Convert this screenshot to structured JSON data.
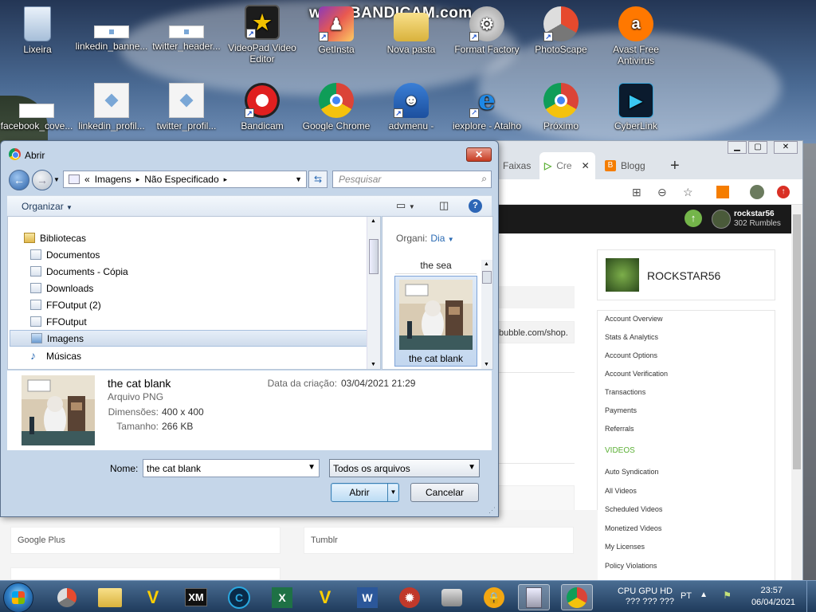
{
  "desktop": {
    "watermark": "www.BANDICAM.com",
    "row1": [
      {
        "label": "Lixeira",
        "icon": "recycle-bin-icon"
      },
      {
        "label": "linkedin_banne...",
        "icon": "image-file-icon"
      },
      {
        "label": "twitter_header...",
        "icon": "image-file-icon"
      },
      {
        "label": "VideoPad Video Editor",
        "icon": "videopad-icon"
      },
      {
        "label": "GetInsta",
        "icon": "getinsta-icon"
      },
      {
        "label": "Nova pasta",
        "icon": "folder-icon"
      },
      {
        "label": "Format Factory",
        "icon": "format-factory-icon"
      },
      {
        "label": "PhotoScape",
        "icon": "photoscape-icon"
      },
      {
        "label": "Avast Free Antivirus",
        "icon": "avast-icon"
      }
    ],
    "row2": [
      {
        "label": "facebook_cove...",
        "icon": "image-file-icon"
      },
      {
        "label": "linkedin_profil...",
        "icon": "image-file-icon"
      },
      {
        "label": "twitter_profil...",
        "icon": "image-file-icon"
      },
      {
        "label": "Bandicam",
        "icon": "bandicam-icon"
      },
      {
        "label": "Google Chrome",
        "icon": "chrome-icon"
      },
      {
        "label": "advmenu -",
        "icon": "advmenu-icon"
      },
      {
        "label": "iexplore - Atalho",
        "icon": "ie-icon"
      },
      {
        "label": "Próximo",
        "icon": "chrome-icon"
      },
      {
        "label": "CyberLink",
        "icon": "cyberlink-icon"
      }
    ]
  },
  "browser": {
    "tabs": [
      "Faixas",
      "Cre",
      "Blogg"
    ],
    "new_tab": "+",
    "user_name": "rockstar56",
    "user_rumbles": "302 Rumbles",
    "url_partial": "bubble.com/shop.",
    "profile_name": "ROCKSTAR56",
    "menu": [
      "Account Overview",
      "Stats & Analytics",
      "Account Options",
      "Account Verification",
      "Transactions",
      "Payments",
      "Referrals"
    ],
    "videos_heading": "VIDEOS",
    "videos_menu": [
      "Auto Syndication",
      "All Videos",
      "Scheduled Videos",
      "Monetized Videos",
      "My Licenses",
      "Policy Violations"
    ],
    "fields": [
      "Google Plus",
      "Tumblr"
    ]
  },
  "dialog": {
    "title": "Abrir",
    "breadcrumb": [
      "«",
      "Imagens",
      "▸",
      "Não Especificado",
      "▸"
    ],
    "search_placeholder": "Pesquisar",
    "organize": "Organizar",
    "nav_items": [
      {
        "label": "Bibliotecas",
        "lib": true
      },
      {
        "label": "Documentos"
      },
      {
        "label": "Documents - Cópia"
      },
      {
        "label": "Downloads"
      },
      {
        "label": "FFOutput (2)"
      },
      {
        "label": "FFOutput"
      },
      {
        "label": "Imagens",
        "selected": true
      },
      {
        "label": "Músicas"
      }
    ],
    "arrange_label": "Organi:",
    "arrange_value": "Dia",
    "group_label": "the sea",
    "thumb_caption": "the cat blank",
    "details": {
      "name": "the cat blank",
      "type": "Arquivo PNG",
      "dims_label": "Dimensões:",
      "dims": "400 x 400",
      "size_label": "Tamanho:",
      "size": "266 KB",
      "created_label": "Data da criação:",
      "created": "03/04/2021 21:29"
    },
    "name_label": "Nome:",
    "name_value": "the cat blank",
    "filter": "Todos os arquivos",
    "open": "Abrir",
    "cancel": "Cancelar"
  },
  "taskbar": {
    "tray_line1": "CPU GPU HD",
    "tray_line2": "???  ???  ???",
    "lang": "PT",
    "time": "23:57",
    "date": "06/04/2021"
  }
}
